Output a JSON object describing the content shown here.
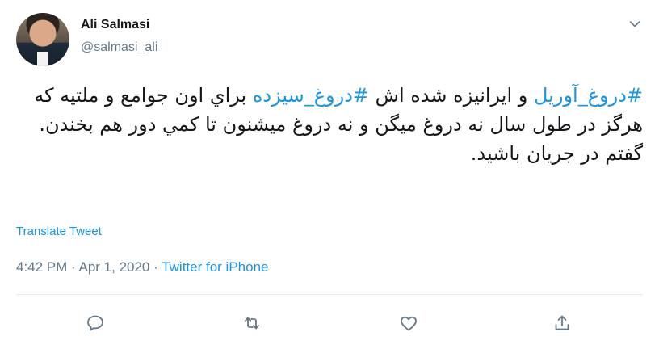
{
  "user": {
    "name": "Ali Salmasi",
    "handle": "@salmasi_ali"
  },
  "tweet": {
    "hashtag_1": "#دروغ_آوریل",
    "text_1": " و ایرانیزه شده اش ",
    "hashtag_2": "#دروغ_سیزده",
    "text_2": " براي اون جوامع و ملتیه که هرگز در طول سال نه دروغ میگن و نه دروغ میشنون تا کمي دور هم بخندن.",
    "line_2": "گفتم در جریان باشید."
  },
  "translate_label": "Translate Tweet",
  "meta": {
    "time": "4:42 PM",
    "sep1": " · ",
    "date": "Apr 1, 2020",
    "sep2": " · ",
    "source": "Twitter for iPhone"
  },
  "icons": {
    "caret": "chevron-down-icon",
    "reply": "reply-icon",
    "retweet": "retweet-icon",
    "like": "heart-icon",
    "share": "share-icon"
  },
  "colors": {
    "link": "#1b95e0",
    "secondary": "#657786",
    "text": "#14171a"
  }
}
